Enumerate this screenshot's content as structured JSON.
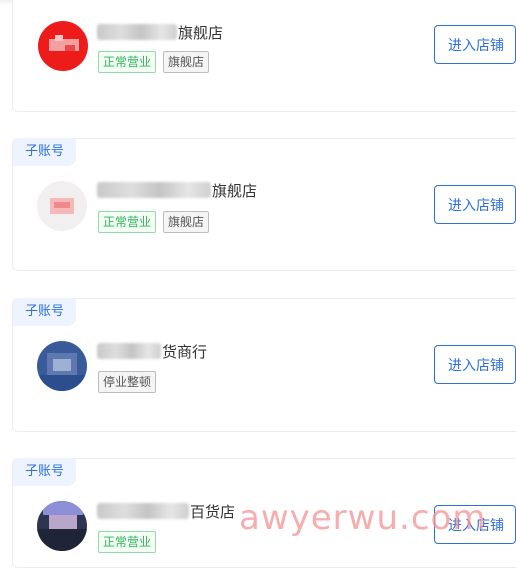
{
  "stores": [
    {
      "sub_label": "",
      "name_suffix": "旗舰店",
      "badges": [
        "正常营业",
        "旗舰店"
      ],
      "enter_label": "进入店铺",
      "avatar_color": "#ee1b1b"
    },
    {
      "sub_label": "子账号",
      "name_suffix": "旗舰店",
      "badges": [
        "正常营业",
        "旗舰店"
      ],
      "enter_label": "进入店铺",
      "avatar_color": "#f2b3b3"
    },
    {
      "sub_label": "子账号",
      "name_suffix": "货商行",
      "badges": [
        "停业整顿"
      ],
      "enter_label": "进入店铺",
      "avatar_color": "#3a5b9a"
    },
    {
      "sub_label": "子账号",
      "name_suffix": "百货店",
      "badges": [
        "正常营业"
      ],
      "enter_label": "进入店铺",
      "avatar_color": "#2d3552"
    }
  ],
  "watermark": "awyerwu.com",
  "colors": {
    "accent": "#2f6fd6",
    "open": "#32b35b"
  }
}
